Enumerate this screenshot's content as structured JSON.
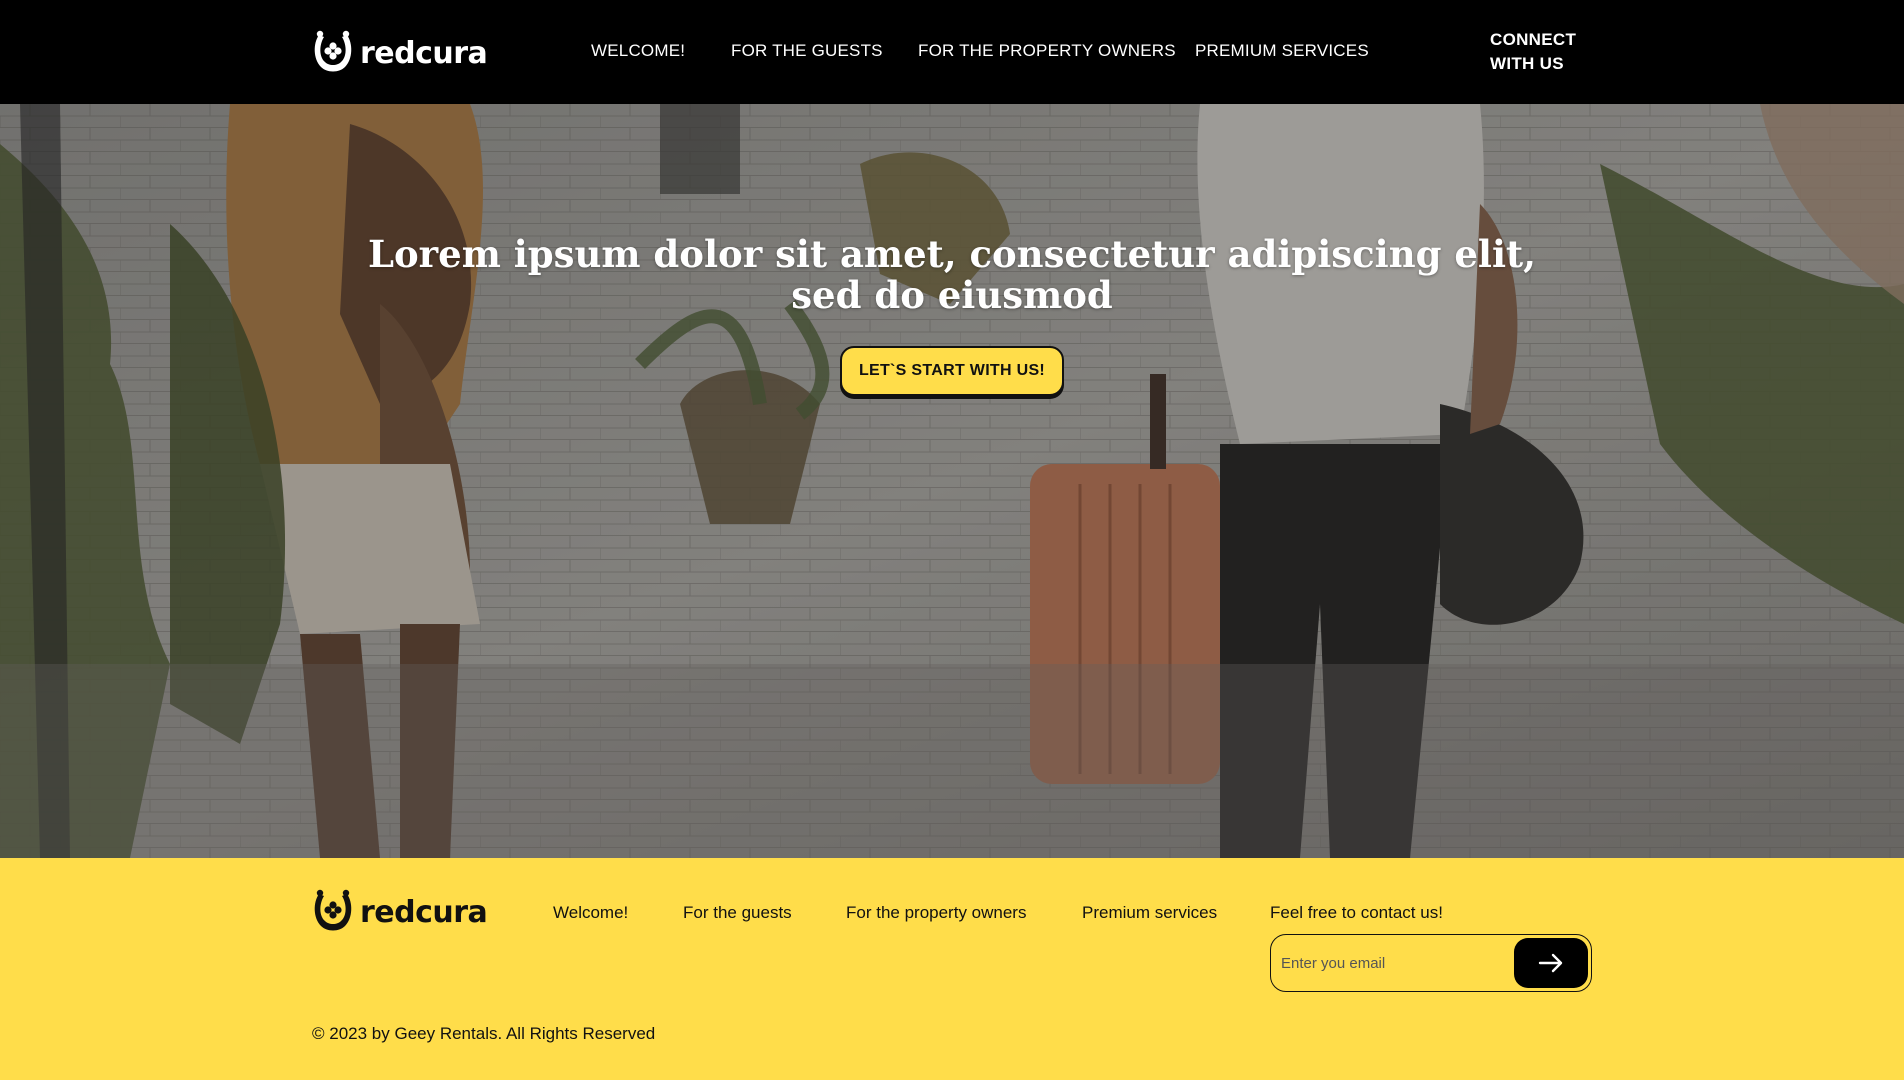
{
  "brand": {
    "name": "redcura"
  },
  "header": {
    "nav": [
      {
        "label": "WELCOME!"
      },
      {
        "label": "FOR THE GUESTS"
      },
      {
        "label": "FOR THE PROPERTY OWNERS"
      },
      {
        "label": "PREMIUM SERVICES"
      }
    ],
    "connect_line1": "CONNECT",
    "connect_line2": "WITH US"
  },
  "hero": {
    "title": "Lorem ipsum dolor sit amet, consectetur adipiscing elit, sed do eiusmod",
    "cta_label": "LET`S START WITH US!"
  },
  "footer": {
    "links": [
      {
        "label": "Welcome!"
      },
      {
        "label": "For the guests"
      },
      {
        "label": "For the property owners"
      },
      {
        "label": "Premium services"
      }
    ],
    "contact_label": "Feel free to contact us!",
    "email_placeholder": "Enter you email",
    "email_value": "",
    "copyright": "© 2023 by Geey Rentals. All Rights Reserved"
  },
  "icons": {
    "logo": "horseshoe-clover-icon",
    "submit": "arrow-right-icon"
  },
  "colors": {
    "accent": "#ffdd4a",
    "header_bg": "#000000",
    "text_dark": "#111111"
  }
}
